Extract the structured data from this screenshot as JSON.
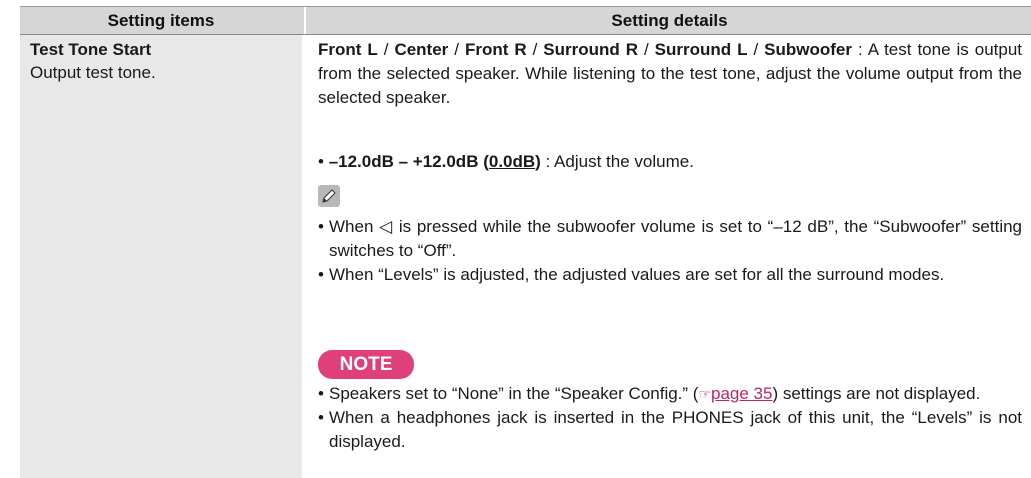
{
  "header": {
    "col1": "Setting items",
    "col2": "Setting details"
  },
  "item": {
    "title": "Test Tone Start",
    "desc": "Output test tone."
  },
  "details": {
    "speakers": {
      "front_l": "Front L",
      "center": "Center",
      "front_r": "Front R",
      "surround_r": "Surround R",
      "surround_l": "Surround L",
      "subwoofer": "Subwoofer",
      "separator": " / ",
      "text": " : A test tone is output from the selected speaker. While listening to the test tone, adjust the volume output from the selected speaker."
    },
    "range": {
      "bullet": "•",
      "range": "–12.0dB – +12.0dB",
      "paren_open": " (",
      "default": "0.0dB",
      "paren_close": ")",
      "text": " : Adjust the volume."
    },
    "tips": [
      {
        "bullet": "•",
        "text": "When ◁ is pressed while the subwoofer volume is set to “–12 dB”, the “Subwoofer” setting switches to “Off”."
      },
      {
        "bullet": "•",
        "text": "When “Levels” is adjusted, the adjusted values are set for all the surround modes."
      }
    ],
    "note_label": "NOTE",
    "notes": [
      {
        "bullet": "•",
        "text_before": "Speakers set to “None” in the “Speaker Config.” (",
        "link": "page 35",
        "text_after": ") settings are not displayed."
      },
      {
        "bullet": "•",
        "text": "When a headphones jack is inserted in the PHONES jack of this unit, the “Levels” is not displayed."
      }
    ]
  },
  "icons": {
    "pencil": "pencil-icon",
    "page_ref": "pointing-hand-icon"
  },
  "colors": {
    "header_bg": "#d6d6d6",
    "left_col_bg": "#e8e8e8",
    "note_badge": "#e0407a",
    "link": "#c0226a"
  }
}
